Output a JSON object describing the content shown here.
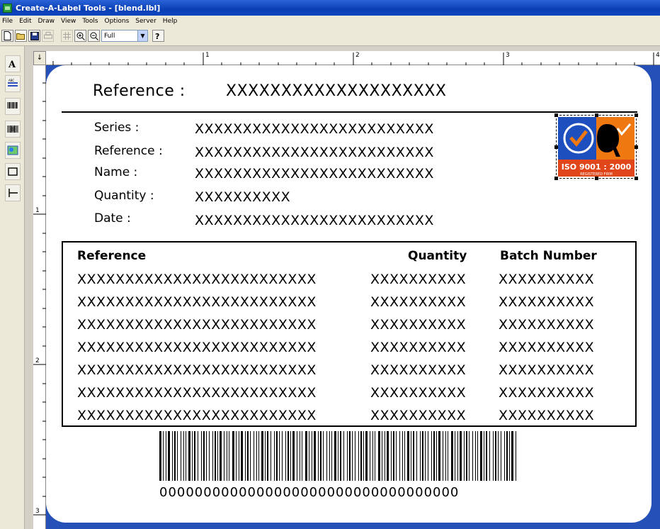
{
  "window": {
    "title": "Create-A-Label Tools - [blend.lbl]"
  },
  "menu": [
    "File",
    "Edit",
    "Draw",
    "View",
    "Tools",
    "Options",
    "Server",
    "Help"
  ],
  "toolbar": {
    "zoom_value": "Full",
    "zoom_options": [
      "Full"
    ]
  },
  "palette": [
    "text-tool-icon",
    "text-box-tool-icon",
    "barcode-tool-icon",
    "2d-barcode-tool-icon",
    "image-tool-icon",
    "rectangle-tool-icon",
    "line-tool-icon"
  ],
  "ruler": {
    "corner": "↓",
    "h_marks": [
      "1",
      "2",
      "3",
      "4"
    ],
    "v_marks": [
      "1",
      "2",
      "3"
    ]
  },
  "label": {
    "ref_title": "Reference :",
    "ref_value": "XXXXXXXXXXXXXXXXXXXX",
    "fields": [
      {
        "label": "Series :",
        "value": "XXXXXXXXXXXXXXXXXXXXXXXXX"
      },
      {
        "label": "Reference :",
        "value": "XXXXXXXXXXXXXXXXXXXXXXXXX"
      },
      {
        "label": "Name :",
        "value": "XXXXXXXXXXXXXXXXXXXXXXXXX"
      },
      {
        "label": "Quantity :",
        "value": "XXXXXXXXXX"
      },
      {
        "label": "Date :",
        "value": "XXXXXXXXXXXXXXXXXXXXXXXXX"
      }
    ],
    "logo": {
      "text": "ISO 9001 : 2000",
      "subtext": "REGISTERED FIRM"
    },
    "table": {
      "headers": {
        "reference": "Reference",
        "quantity": "Quantity",
        "batch": "Batch Number"
      },
      "rows": [
        {
          "reference": "XXXXXXXXXXXXXXXXXXXXXXXXX",
          "quantity": "XXXXXXXXXX",
          "batch": "XXXXXXXXXX"
        },
        {
          "reference": "XXXXXXXXXXXXXXXXXXXXXXXXX",
          "quantity": "XXXXXXXXXX",
          "batch": "XXXXXXXXXX"
        },
        {
          "reference": "XXXXXXXXXXXXXXXXXXXXXXXXX",
          "quantity": "XXXXXXXXXX",
          "batch": "XXXXXXXXXX"
        },
        {
          "reference": "XXXXXXXXXXXXXXXXXXXXXXXXX",
          "quantity": "XXXXXXXXXX",
          "batch": "XXXXXXXXXX"
        },
        {
          "reference": "XXXXXXXXXXXXXXXXXXXXXXXXX",
          "quantity": "XXXXXXXXXX",
          "batch": "XXXXXXXXXX"
        },
        {
          "reference": "XXXXXXXXXXXXXXXXXXXXXXXXX",
          "quantity": "XXXXXXXXXX",
          "batch": "XXXXXXXXXX"
        },
        {
          "reference": "XXXXXXXXXXXXXXXXXXXXXXXXX",
          "quantity": "XXXXXXXXXX",
          "batch": "XXXXXXXXXX"
        }
      ]
    },
    "barcode_digits": "0000000000000000000000000000000000"
  },
  "colors": {
    "title_bar": "#0a3fb4",
    "canvas_bg": "#2450b8",
    "chrome": "#ece9d8"
  }
}
